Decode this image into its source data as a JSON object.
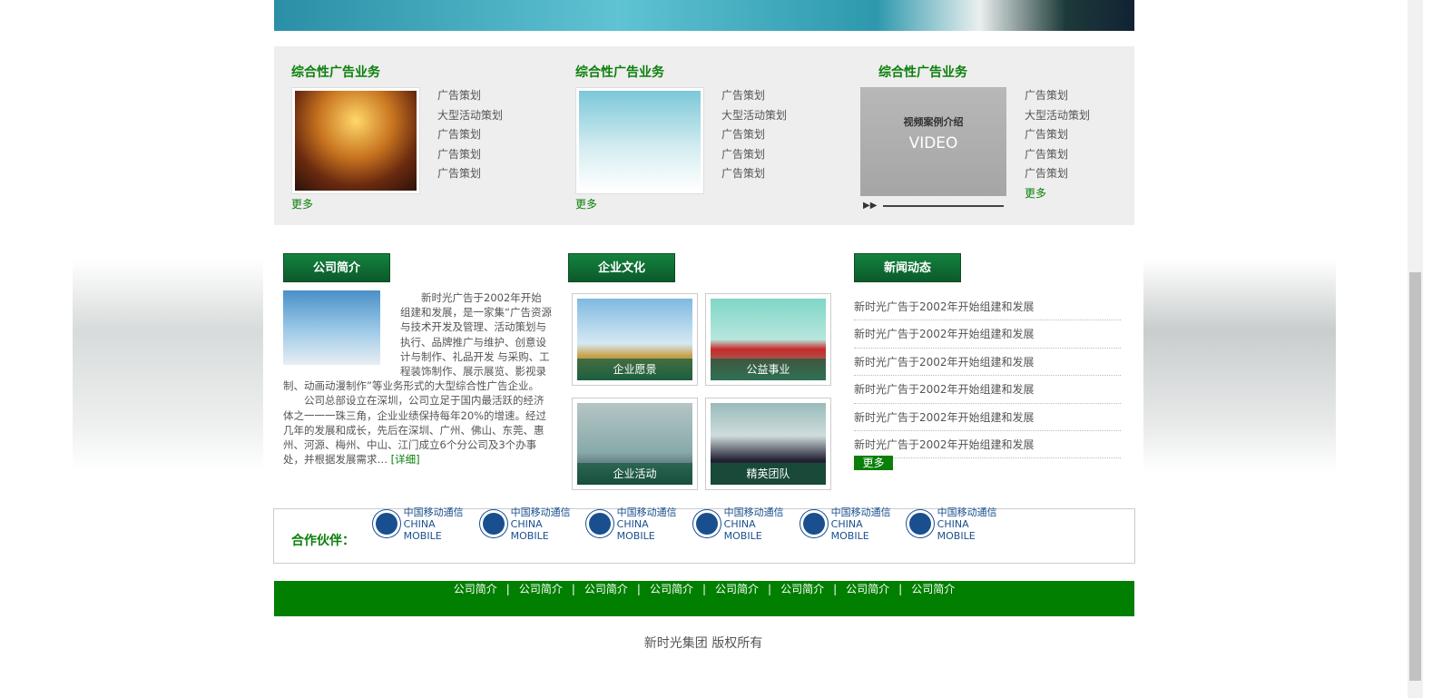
{
  "services": [
    {
      "title": "综合性广告业务",
      "links": [
        "广告策划",
        "大型活动策划",
        "广告策划",
        "广告策划",
        "广告策划"
      ],
      "more": "更多"
    },
    {
      "title": "综合性广告业务",
      "links": [
        "广告策划",
        "大型活动策划",
        "广告策划",
        "广告策划",
        "广告策划"
      ],
      "more": "更多"
    },
    {
      "title": "综合性广告业务",
      "links": [
        "广告策划",
        "大型活动策划",
        "广告策划",
        "广告策划",
        "广告策划"
      ],
      "more": "更多",
      "video_title": "视频案例介绍",
      "video_label": "VIDEO"
    }
  ],
  "intro": {
    "title": "公司简介",
    "p1": "新时光广告于2002年开始组建和发展，是一家集“广告资源与技术开发及管理、活动策划与执行、品牌推广与维护、创意设计与制作、礼品开发 与采购、工程装饰制作、展示展览、影视录制、动画动漫制作”等业务形式的大型综合性广告企业。",
    "p2": "公司总部设立在深圳，公司立足于国内最活跃的经济体之一一一珠三角，企业业绩保持每年20%的增速。经过几年的发展和成长，先后在深圳、广州、佛山、东莞、惠州、河源、梅州、中山、江门成立6个分公司及3个办事处，并根据发展需求…",
    "detail": "[详细]"
  },
  "culture": {
    "title": "企业文化",
    "items": [
      "企业愿景",
      "公益事业",
      "企业活动",
      "精英团队"
    ]
  },
  "news": {
    "title": "新闻动态",
    "items": [
      "新时光广告于2002年开始组建和发展",
      "新时光广告于2002年开始组建和发展",
      "新时光广告于2002年开始组建和发展",
      "新时光广告于2002年开始组建和发展",
      "新时光广告于2002年开始组建和发展",
      "新时光广告于2002年开始组建和发展"
    ],
    "more": "更多"
  },
  "partners": {
    "label": "合作伙伴：",
    "logo_cn": "中国移动通信",
    "logo_en": "CHINA MOBILE"
  },
  "footer": {
    "links": [
      "公司简介",
      "公司简介",
      "公司简介",
      "公司简介",
      "公司简介",
      "公司简介",
      "公司简介",
      "公司简介"
    ],
    "sep": "|",
    "copyright": "新时光集团 版权所有"
  },
  "colors": {
    "green": "#007f00",
    "header_green": "#0b5a2a"
  }
}
